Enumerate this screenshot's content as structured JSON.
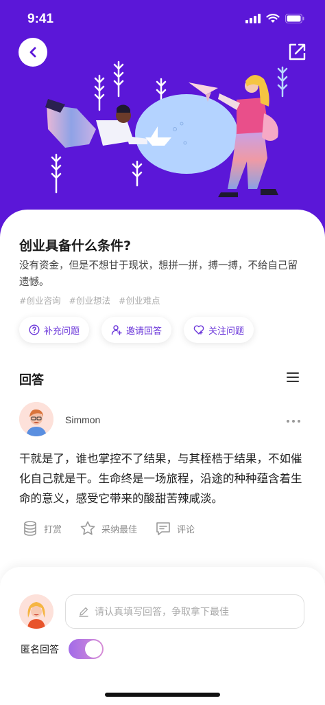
{
  "status_bar": {
    "time": "9:41"
  },
  "question": {
    "title": "创业具备什么条件?",
    "description": "没有资金，但是不想甘于现状，想拼一拼，搏一搏，不给自己留遗憾。",
    "tags": [
      "#创业咨询",
      "#创业想法",
      "#创业难点"
    ]
  },
  "actions": [
    {
      "label": "补充问题",
      "icon": "question-circle-icon"
    },
    {
      "label": "邀请回答",
      "icon": "add-user-icon"
    },
    {
      "label": "关注问题",
      "icon": "heart-icon"
    }
  ],
  "answers_section": {
    "title": "回答"
  },
  "answer": {
    "author": "Simmon",
    "text": "干就是了，谁也掌控不了结果，与其桎梏于结果，不如催化自己就是干。生命终是一场旅程，沿途的种种蕴含着生命的意义，感受它带来的酸甜苦辣咸淡。",
    "ops": [
      {
        "label": "打赏",
        "icon": "coin-stack-icon"
      },
      {
        "label": "采纳最佳",
        "icon": "star-icon"
      },
      {
        "label": "评论",
        "icon": "comment-icon"
      }
    ]
  },
  "composer": {
    "placeholder": "请认真填写回答，争取拿下最佳",
    "anonymous_label": "匿名回答",
    "anonymous_on": true
  },
  "colors": {
    "hero": "#5b17d8",
    "accent": "#6a35d9"
  }
}
